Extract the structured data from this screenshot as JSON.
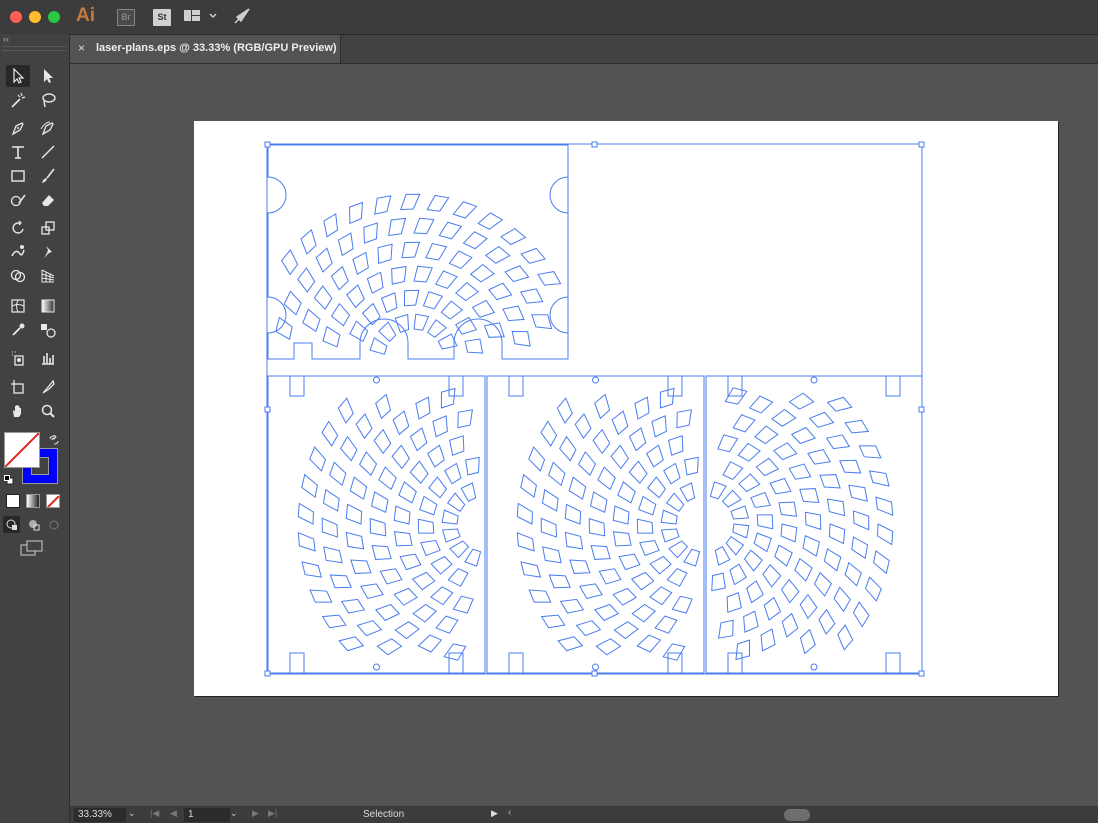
{
  "app": {
    "logo": "Ai",
    "bridge_label": "Br",
    "stock_label": "St",
    "workspace_dropdown": "⌄"
  },
  "toolbox": {
    "collapse_label": "‹‹",
    "tools": [
      {
        "name": "selection-tool"
      },
      {
        "name": "direct-selection-tool"
      },
      {
        "name": "magic-wand-tool"
      },
      {
        "name": "lasso-tool"
      },
      {
        "name": "pen-tool"
      },
      {
        "name": "curvature-tool"
      },
      {
        "name": "type-tool"
      },
      {
        "name": "line-segment-tool"
      },
      {
        "name": "rectangle-tool"
      },
      {
        "name": "paintbrush-tool"
      },
      {
        "name": "shaper-tool"
      },
      {
        "name": "eraser-tool"
      },
      {
        "name": "rotate-tool"
      },
      {
        "name": "scale-tool"
      },
      {
        "name": "warp-tool"
      },
      {
        "name": "puppet-warp-tool"
      },
      {
        "name": "shape-builder-tool"
      },
      {
        "name": "perspective-grid-tool"
      },
      {
        "name": "mesh-tool"
      },
      {
        "name": "gradient-tool"
      },
      {
        "name": "eyedropper-tool"
      },
      {
        "name": "blend-tool"
      },
      {
        "name": "symbol-sprayer-tool"
      },
      {
        "name": "column-graph-tool"
      },
      {
        "name": "artboard-tool"
      },
      {
        "name": "slice-tool"
      },
      {
        "name": "hand-tool"
      },
      {
        "name": "zoom-tool"
      }
    ],
    "fill_color": "none",
    "stroke_color": "#0000ff"
  },
  "document": {
    "tab_close": "×",
    "tab_title": "laser-plans.eps @ 33.33% (RGB/GPU Preview)"
  },
  "statusbar": {
    "zoom": "33.33%",
    "zoom_dropdown": "⌄",
    "first_page": "|◀",
    "prev_page": "◀",
    "page": "1",
    "page_dropdown": "⌄",
    "next_page": "▶",
    "last_page": "▶|",
    "tool_label": "Selection",
    "play": "▶",
    "back": "‹"
  },
  "colors": {
    "selection": "#4a7cf0",
    "artboard": "#ffffff",
    "pasteboard": "#535353"
  }
}
